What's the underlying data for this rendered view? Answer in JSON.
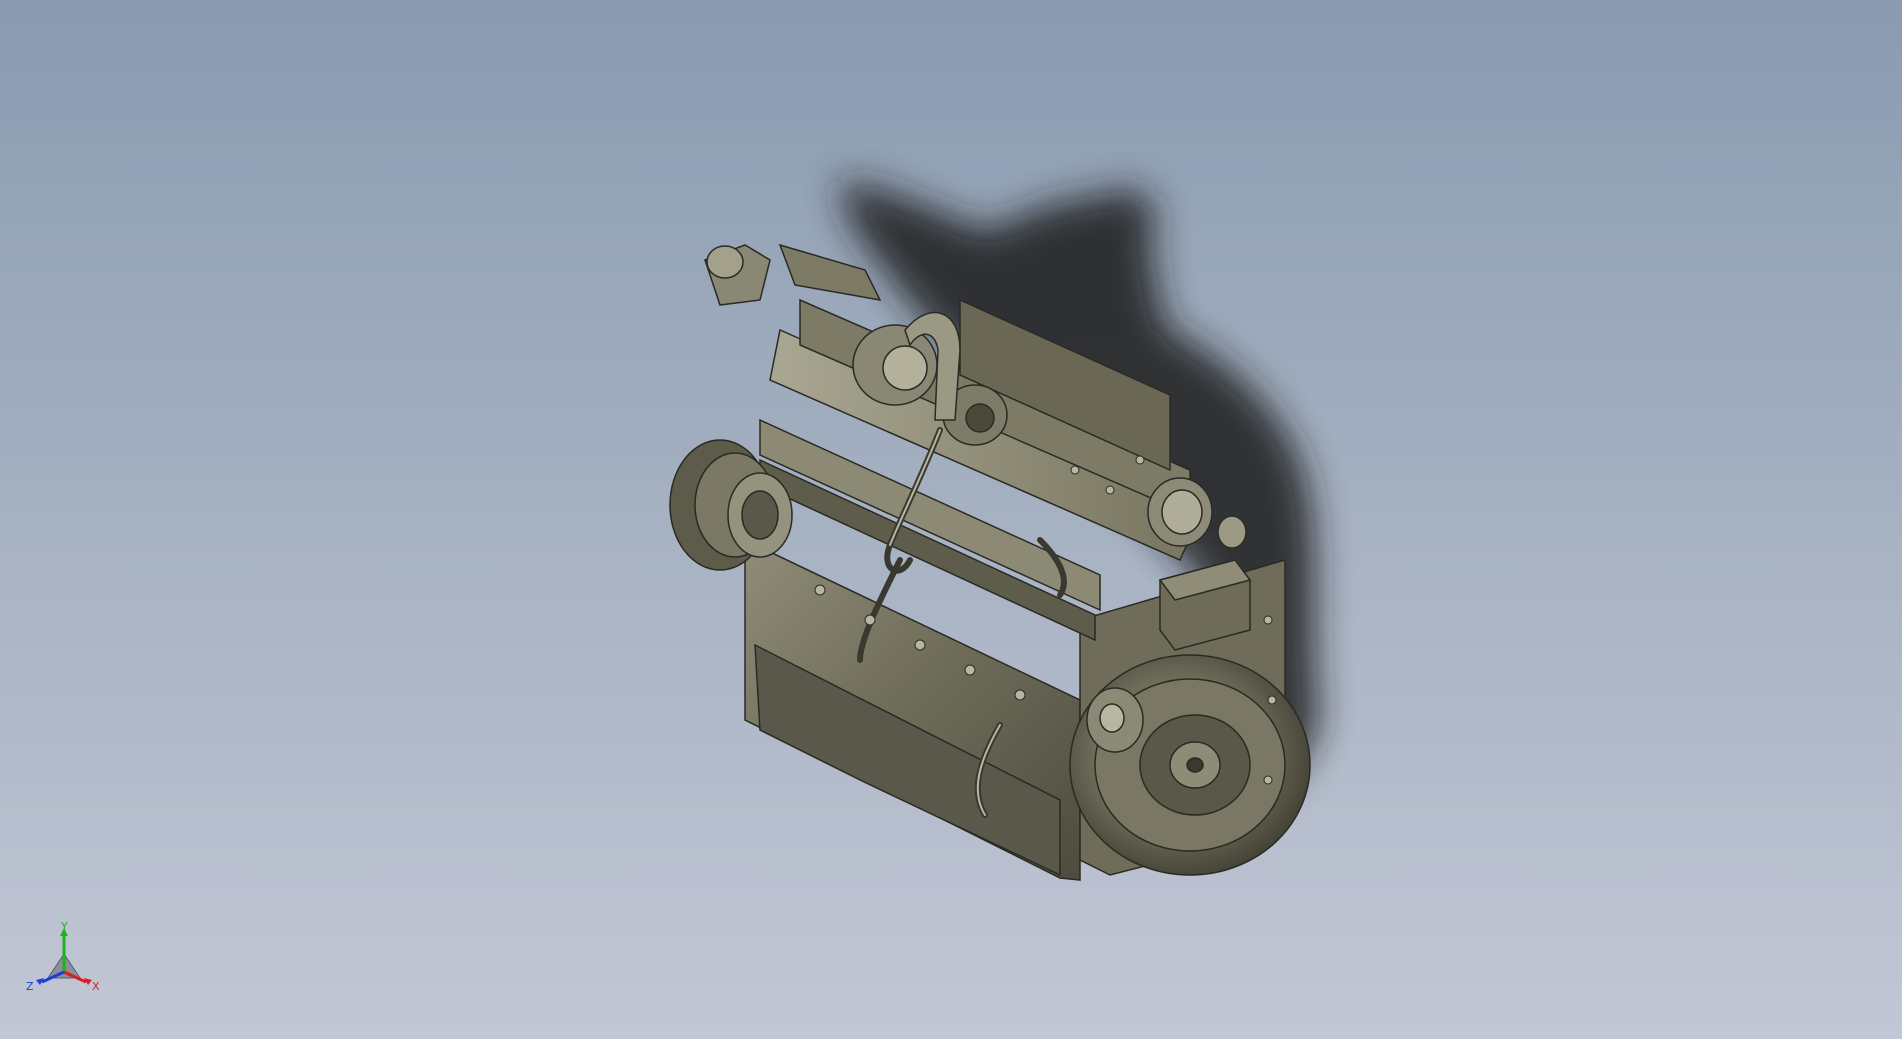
{
  "viewport": {
    "background_top": "#8a9bb0",
    "background_bottom": "#c2c7d5"
  },
  "model": {
    "icon": "engine-model",
    "shadow_color": "#1e1e1e",
    "body_color": "#6d6b58",
    "highlight_color": "#b8b6a2",
    "edge_color": "#2a2a24"
  },
  "triad": {
    "x_label": "X",
    "y_label": "Y",
    "z_label": "Z",
    "x_color": "#d42020",
    "y_color": "#1fb31f",
    "z_color": "#1e3fd6"
  }
}
